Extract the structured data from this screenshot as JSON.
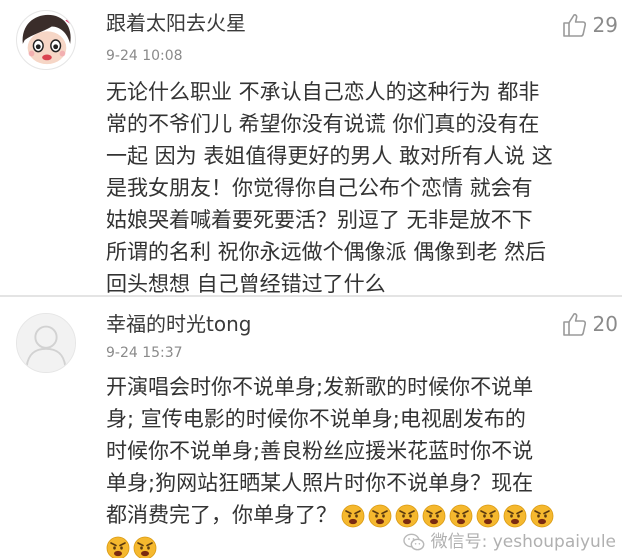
{
  "comments": [
    {
      "username": "跟着太阳去火星",
      "timestamp": "9-24 10:08",
      "likes": "29",
      "avatar_icon": "cartoon-girl-avatar",
      "lines": [
        "无论什么职业 不承认自己恋人的这种行为 都非",
        "常的不爷们儿 希望你没有说谎 你们真的没有在",
        "一起 因为 表姐值得更好的男人 敢对所有人说 这",
        "是我女朋友！你觉得你自己公布个恋情 就会有",
        "姑娘哭着喊着要死要活？别逗了 无非是放不下",
        "所谓的名利 祝你永远做个偶像派 偶像到老 然后",
        "回头想想 自己曾经错过了什么"
      ]
    },
    {
      "username": "幸福的时光tong",
      "timestamp": "9-24 15:37",
      "likes": "20",
      "avatar_icon": "default-user-avatar",
      "lines": [
        "开演唱会时你不说单身;发新歌的时候你不说单",
        "身;  宣传电影的时候你不说单身;电视剧发布的",
        "时候你不说单身;善良粉丝应援米花蓝时你不说",
        "单身;狗网站狂晒某人照片时你不说单身？现在",
        "都消费完了，你单身了？"
      ],
      "emoji_icon": "angry-face-emoji"
    }
  ],
  "watermark": {
    "text": "微信号: yeshoupaiyule",
    "icon": "wechat-icon"
  },
  "colors": {
    "username": "#3a3a3a",
    "meta": "#8a8a8a",
    "body": "#333333",
    "divider": "#e4e4e4",
    "emoji": "#f5b82e"
  }
}
